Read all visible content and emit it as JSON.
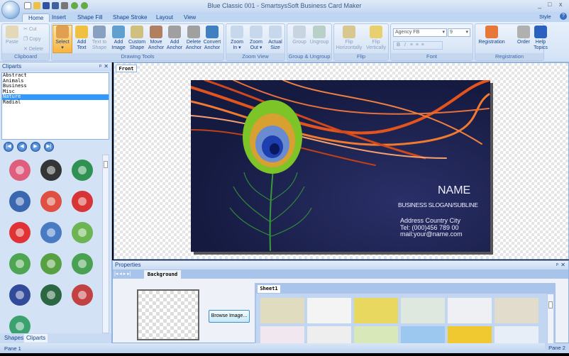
{
  "window": {
    "title": "Blue Classic 001 - SmartsysSoft Business Card Maker",
    "minimize": "_",
    "maximize": "□",
    "close": "x",
    "style_label": "Style",
    "help_icon": "?"
  },
  "ribbon_tabs": [
    "Home",
    "Insert",
    "Shape Fill",
    "Shape Stroke",
    "Layout",
    "View"
  ],
  "groups": {
    "clipboard": {
      "label": "Clipboard",
      "paste": "Paste",
      "cut": "Cut",
      "copy": "Copy",
      "delete": "Delete"
    },
    "drawing": {
      "label": "Drawing Tools",
      "buttons": [
        {
          "l1": "Select",
          "l2": "▾"
        },
        {
          "l1": "Add",
          "l2": "Text"
        },
        {
          "l1": "Text to",
          "l2": "Shape"
        },
        {
          "l1": "Add",
          "l2": "Image"
        },
        {
          "l1": "Custom",
          "l2": "Shape"
        },
        {
          "l1": "Move",
          "l2": "Anchor"
        },
        {
          "l1": "Add",
          "l2": "Anchor"
        },
        {
          "l1": "Delete",
          "l2": "Anchor"
        },
        {
          "l1": "Convert",
          "l2": "Anchor"
        }
      ]
    },
    "zoom": {
      "label": "Zoom View",
      "buttons": [
        {
          "l1": "Zoom",
          "l2": "In ▾"
        },
        {
          "l1": "Zoom",
          "l2": "Out ▾"
        },
        {
          "l1": "Actual",
          "l2": "Size"
        }
      ]
    },
    "group": {
      "label": "Group & Ungroup",
      "buttons": [
        {
          "l1": "Group",
          "l2": ""
        },
        {
          "l1": "Ungroup",
          "l2": ""
        }
      ]
    },
    "flip": {
      "label": "Flip",
      "buttons": [
        {
          "l1": "Flip",
          "l2": "Horizontally"
        },
        {
          "l1": "Flip",
          "l2": "Vertically"
        }
      ]
    },
    "font": {
      "label": "Font",
      "family": "Agency FB",
      "size": "9",
      "bold": "B",
      "italic": "I"
    },
    "registration": {
      "label": "Registration",
      "buttons": [
        {
          "l1": "Registration",
          "l2": ""
        },
        {
          "l1": "Order",
          "l2": ""
        },
        {
          "l1": "Help",
          "l2": "Topics"
        }
      ]
    }
  },
  "cliparts": {
    "title": "Cliparts",
    "categories": [
      "Abstract",
      "Animals",
      "Business",
      "Misc",
      "Nature",
      "Radial"
    ],
    "selected": "Nature"
  },
  "left_tabs": [
    "Shapes",
    "Cliparts"
  ],
  "canvas": {
    "tab": "Front"
  },
  "card": {
    "name": "NAME",
    "slogan": "BUSINESS SLOGAN/SUBLINE",
    "address": "Address Country City",
    "tel": "Tel: (000)456 789 00",
    "mail": "mail:your@name.com"
  },
  "properties": {
    "title": "Properties",
    "tab": "Background",
    "browse": "Browse Image...",
    "sheet_tab": "Sheet1"
  },
  "status": {
    "left": "Pane 1",
    "right": "Pane 2"
  }
}
